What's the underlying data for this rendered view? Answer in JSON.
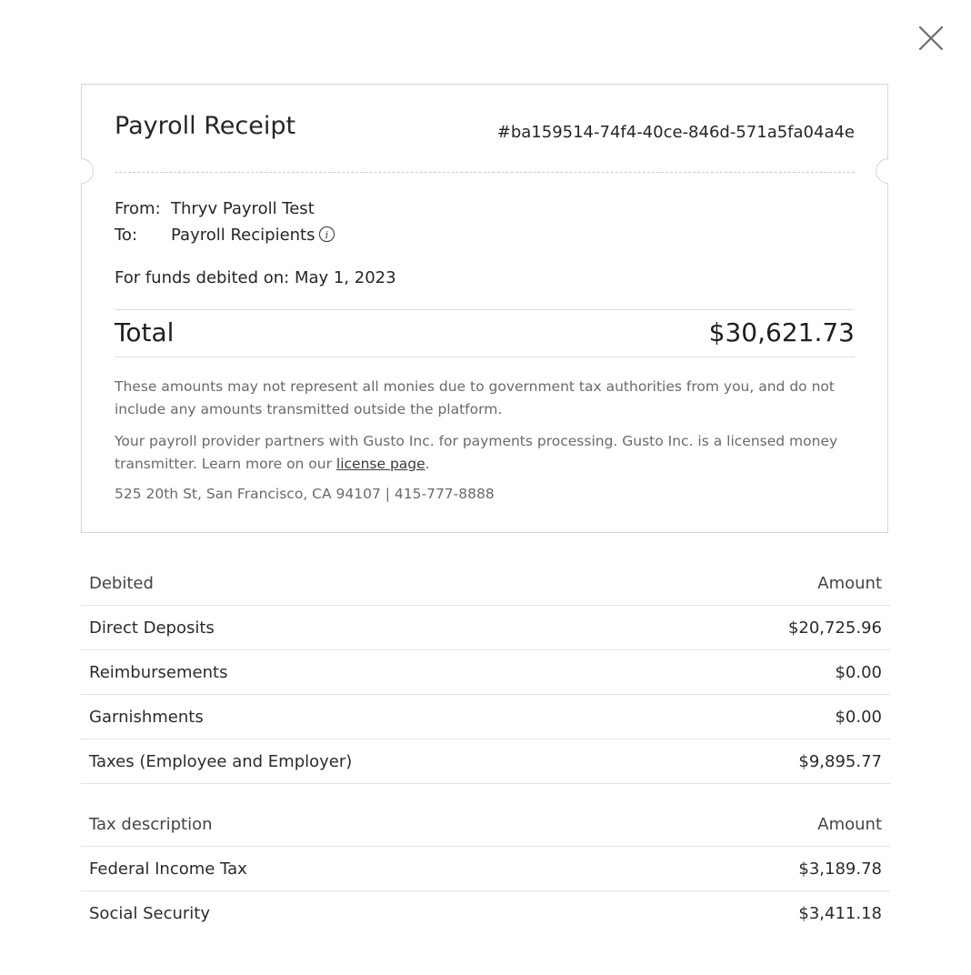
{
  "modal": {
    "close_icon": "close-icon"
  },
  "receipt": {
    "title": "Payroll Receipt",
    "id": "#ba159514-74f4-40ce-846d-571a5fa04a4e",
    "from_label": "From:",
    "from_value": "Thryv Payroll Test",
    "to_label": "To:",
    "to_value": "Payroll Recipients",
    "to_info_icon": "info-icon",
    "funds_debited": "For funds debited on: May 1, 2023",
    "total_label": "Total",
    "total_value": "$30,621.73",
    "disclaimer": "These amounts may not represent all monies due to government tax authorities from you, and do not include any amounts transmitted outside the platform.",
    "partner_text": "Your payroll provider partners with Gusto Inc. for payments processing. Gusto Inc. is a licensed money transmitter. Learn more on our ",
    "license_link": "license page",
    "partner_text_end": ".",
    "address": "525 20th St, San Francisco, CA 94107 | 415-777-8888"
  },
  "debited_table": {
    "headers": [
      "Debited",
      "Amount"
    ],
    "rows": [
      {
        "label": "Direct Deposits",
        "amount": "$20,725.96"
      },
      {
        "label": "Reimbursements",
        "amount": "$0.00"
      },
      {
        "label": "Garnishments",
        "amount": "$0.00"
      },
      {
        "label": "Taxes (Employee and Employer)",
        "amount": "$9,895.77"
      }
    ]
  },
  "tax_table": {
    "headers": [
      "Tax description",
      "Amount"
    ],
    "rows": [
      {
        "label": "Federal Income Tax",
        "amount": "$3,189.78"
      },
      {
        "label": "Social Security",
        "amount": "$3,411.18"
      }
    ]
  }
}
